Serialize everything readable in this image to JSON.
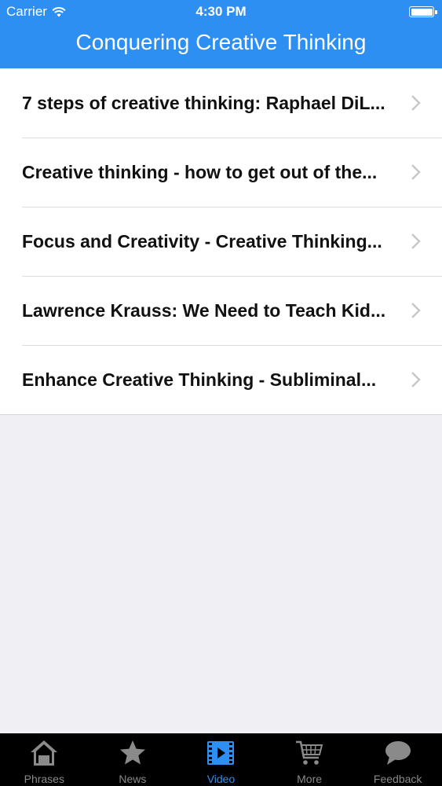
{
  "status": {
    "carrier": "Carrier",
    "time": "4:30 PM"
  },
  "nav": {
    "title": "Conquering Creative Thinking"
  },
  "list": {
    "items": [
      {
        "label": "7 steps of creative thinking: Raphael DiL..."
      },
      {
        "label": "Creative thinking - how to get out of the..."
      },
      {
        "label": "Focus and Creativity - Creative Thinking..."
      },
      {
        "label": "Lawrence Krauss: We Need to Teach Kid..."
      },
      {
        "label": "Enhance Creative Thinking - Subliminal..."
      }
    ]
  },
  "tabbar": {
    "tabs": [
      {
        "label": "Phrases",
        "icon": "home-icon"
      },
      {
        "label": "News",
        "icon": "star-icon"
      },
      {
        "label": "Video",
        "icon": "film-icon",
        "active": true
      },
      {
        "label": "More",
        "icon": "cart-icon"
      },
      {
        "label": "Feedback",
        "icon": "speech-bubble-icon"
      }
    ]
  },
  "colors": {
    "accent": "#2e8ff2",
    "background": "#efeff4",
    "tabbar": "#000000"
  }
}
